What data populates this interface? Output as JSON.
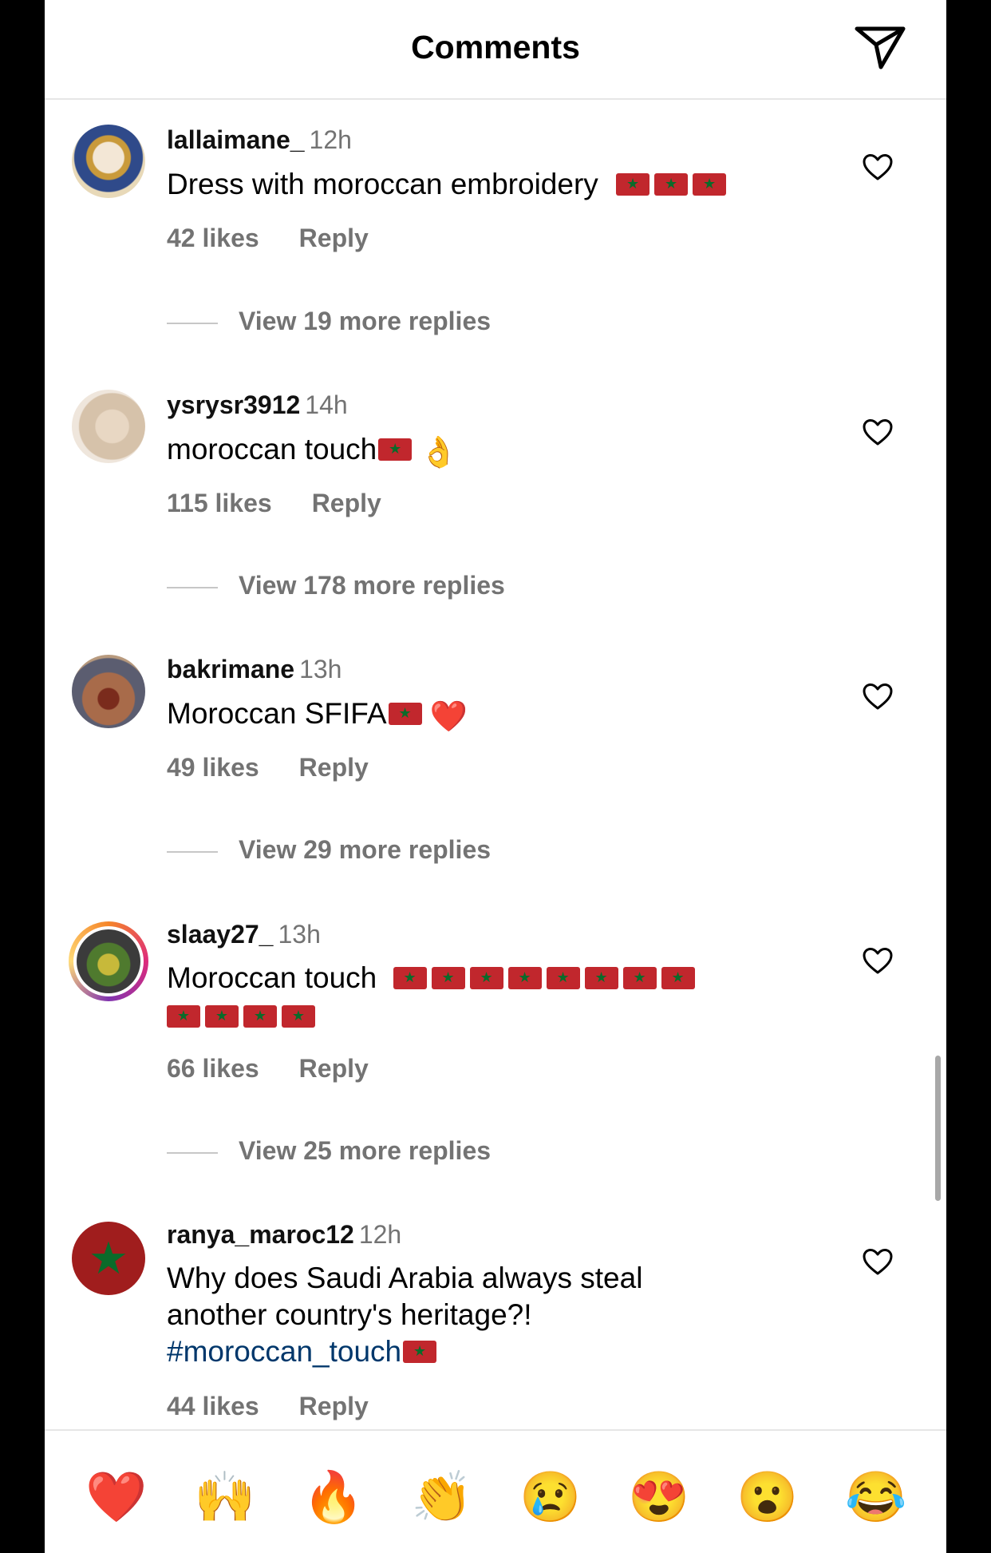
{
  "header": {
    "title": "Comments",
    "share_icon": "send-icon"
  },
  "comments": [
    {
      "username": "lallaimane_",
      "time": "12h",
      "text": "Dress with moroccan embroidery",
      "flags_after_text": 3,
      "likes": "42 likes",
      "reply": "Reply",
      "view_replies": "View 19 more replies"
    },
    {
      "username": "ysrysr3912",
      "time": "14h",
      "text": "moroccan touch",
      "emoji": "👌",
      "likes": "115 likes",
      "reply": "Reply",
      "view_replies": "View 178 more replies"
    },
    {
      "username": "bakrimane",
      "time": "13h",
      "text": "Moroccan SFIFA",
      "emoji": "❤️",
      "likes": "49 likes",
      "reply": "Reply",
      "view_replies": "View 29 more replies"
    },
    {
      "username": "slaay27_",
      "time": "13h",
      "text": "Moroccan touch",
      "flags_after_text": 12,
      "likes": "66 likes",
      "reply": "Reply",
      "view_replies": "View 25 more replies"
    },
    {
      "username": "ranya_maroc12",
      "time": "12h",
      "text_line1": "Why does Saudi Arabia always steal",
      "text_line2": "another country's heritage?!",
      "hashtag": "#moroccan_touch",
      "likes": "44 likes",
      "reply": "Reply"
    }
  ],
  "reactions": [
    "❤️",
    "🙌",
    "🔥",
    "👏",
    "😢",
    "😍",
    "😮",
    "😂"
  ],
  "colors": {
    "flag_red": "#c1272d",
    "flag_star": "#0a6b2a",
    "hashtag": "#00376b",
    "secondary_text": "#737373"
  }
}
